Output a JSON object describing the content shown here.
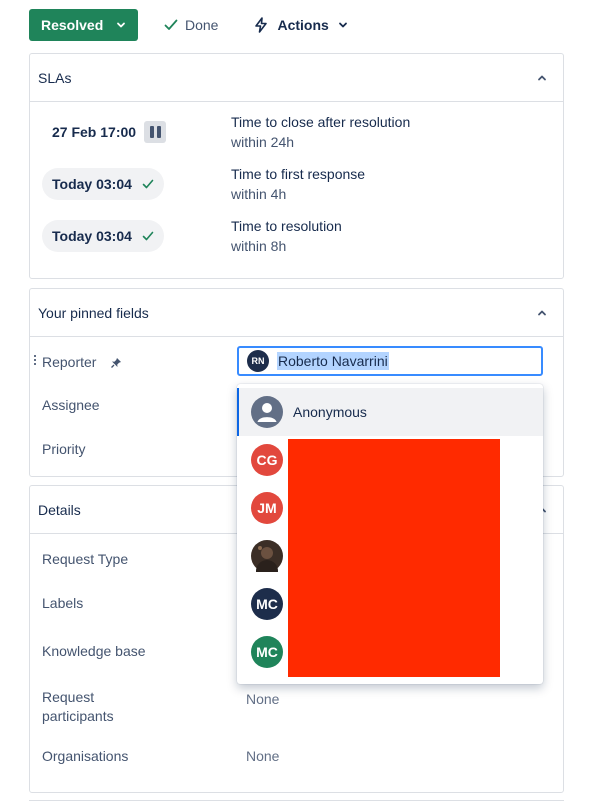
{
  "toolbar": {
    "status_label": "Resolved",
    "done_label": "Done",
    "actions_label": "Actions"
  },
  "sla": {
    "title": "SLAs",
    "rows": [
      {
        "time": "27 Feb 17:00",
        "state": "paused",
        "name": "Time to close after resolution",
        "goal": "within 24h"
      },
      {
        "time": "Today 03:04",
        "state": "met",
        "name": "Time to first response",
        "goal": "within 4h"
      },
      {
        "time": "Today 03:04",
        "state": "met",
        "name": "Time to resolution",
        "goal": "within 8h"
      }
    ]
  },
  "pinned": {
    "title": "Your pinned fields",
    "reporter_label": "Reporter",
    "assignee_label": "Assignee",
    "priority_label": "Priority",
    "reporter_value": "Roberto Navarrini",
    "reporter_initials": "RN"
  },
  "dropdown": {
    "items": [
      {
        "initials": "",
        "label": "Anonymous",
        "color": "#626f86"
      },
      {
        "initials": "CG",
        "label": "",
        "color": "#e2483d"
      },
      {
        "initials": "JM",
        "label": "",
        "color": "#e2483d"
      },
      {
        "initials": "",
        "label": "",
        "color": "#3b2e26"
      },
      {
        "initials": "MC",
        "label": "",
        "color": "#1d2d4b"
      },
      {
        "initials": "MC",
        "label": "",
        "color": "#1f845a"
      }
    ]
  },
  "details": {
    "title": "Details",
    "request_type_label": "Request Type",
    "labels_label": "Labels",
    "kb_label": "Knowledge base",
    "participants_label_1": "Request",
    "participants_label_2": "participants",
    "participants_value": "None",
    "organisations_label": "Organisations",
    "organisations_value": "None"
  }
}
